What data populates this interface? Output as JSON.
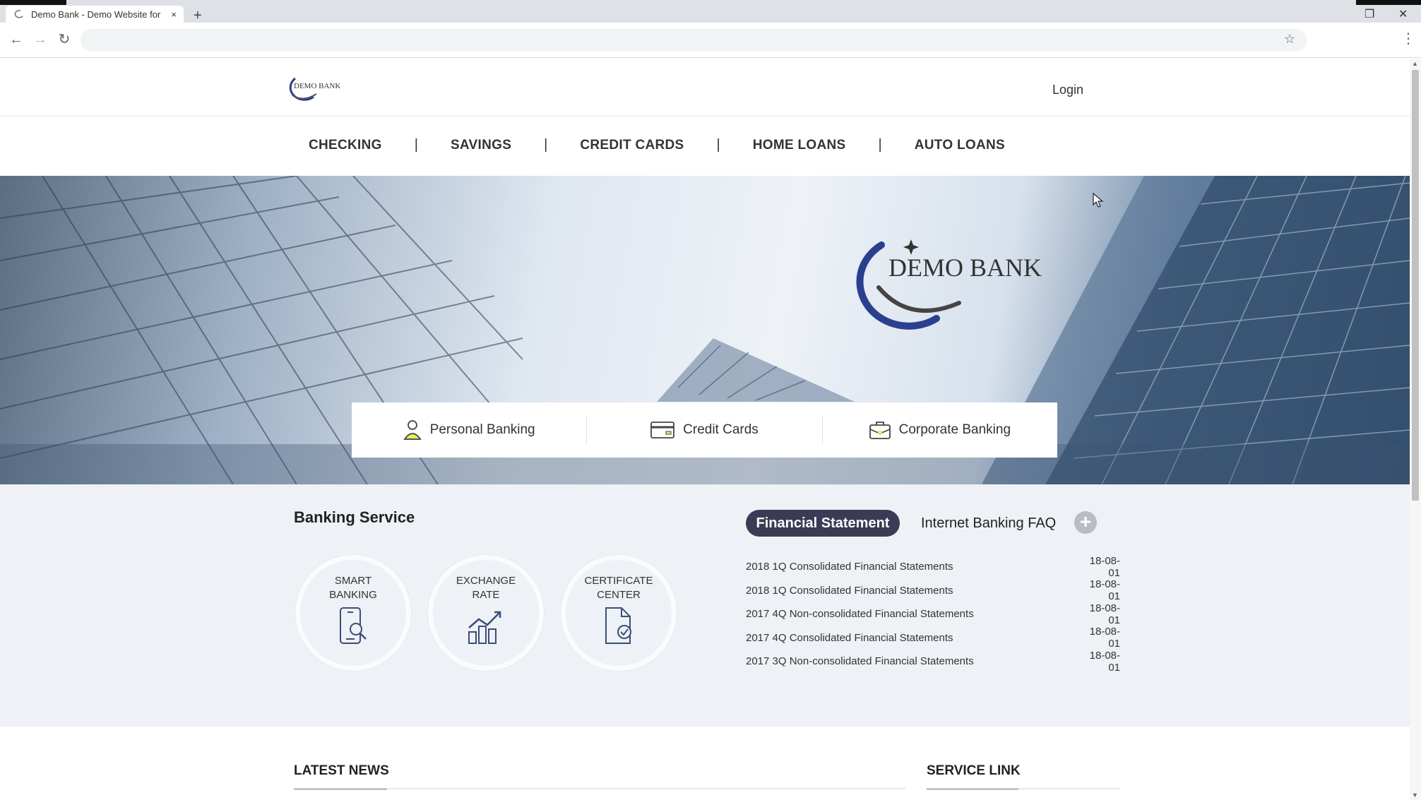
{
  "browser": {
    "tab_title": "Demo Bank - Demo Website for",
    "tab_close": "×",
    "new_tab": "+",
    "url": "",
    "back": "←",
    "forward": "→",
    "reload": "↻",
    "bookmark": "☆",
    "menu": "⋮",
    "restore": "❐",
    "close": "✕"
  },
  "header": {
    "logo_text": "DEMO BANK",
    "login_label": "Login"
  },
  "nav": {
    "items": [
      "CHECKING",
      "SAVINGS",
      "CREDIT CARDS",
      "HOME LOANS",
      "AUTO LOANS"
    ],
    "separator": "|"
  },
  "hero": {
    "logo_text": "DEMO BANK",
    "quicklinks": [
      {
        "label": "Personal Banking",
        "icon": "person-icon"
      },
      {
        "label": "Credit Cards",
        "icon": "credit-card-icon"
      },
      {
        "label": "Corporate Banking",
        "icon": "briefcase-icon"
      }
    ]
  },
  "banking_service": {
    "title": "Banking Service",
    "items": [
      {
        "label": "SMART\nBANKING",
        "icon": "smartphone-search-icon"
      },
      {
        "label": "EXCHANGE\nRATE",
        "icon": "chart-growth-icon"
      },
      {
        "label": "CERTIFICATE\nCENTER",
        "icon": "document-check-icon"
      }
    ]
  },
  "statements": {
    "active_tab": "Financial Statement",
    "other_tab": "Internet Banking FAQ",
    "more": "+",
    "rows": [
      {
        "title": "2018 1Q Consolidated Financial Statements",
        "date": "18-08-01"
      },
      {
        "title": "2018 1Q Consolidated Financial Statements",
        "date": "18-08-01"
      },
      {
        "title": "2017 4Q Non-consolidated Financial Statements",
        "date": "18-08-01"
      },
      {
        "title": "2017 4Q Consolidated Financial Statements",
        "date": "18-08-01"
      },
      {
        "title": "2017 3Q Non-consolidated Financial Statements",
        "date": "18-08-01"
      }
    ]
  },
  "footer_sections": {
    "news_title": "LATEST NEWS",
    "service_link_title": "SERVICE LINK"
  },
  "colors": {
    "accent_dark": "#3b3b55",
    "section_bg": "#eef1f5",
    "logo_blue": "#2b3f8f"
  }
}
